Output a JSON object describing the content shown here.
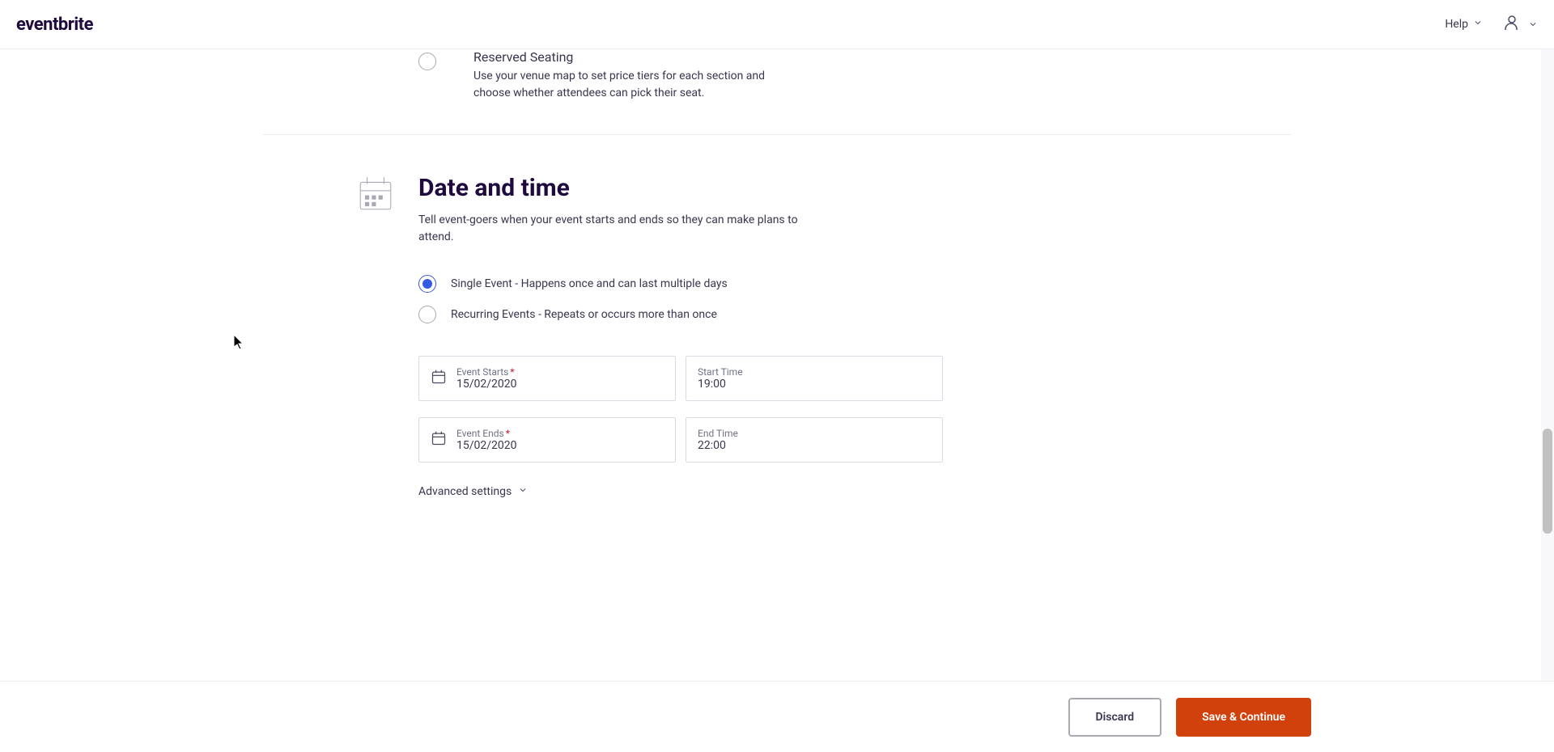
{
  "header": {
    "logo_text": "eventbrite",
    "help_label": "Help"
  },
  "seating": {
    "title": "Reserved Seating",
    "description": "Use your venue map to set price tiers for each section and choose whether attendees can pick their seat."
  },
  "date_section": {
    "heading": "Date and time",
    "description": "Tell event-goers when your event starts and ends so they can make plans to attend.",
    "radio_single": "Single Event - Happens once and can last multiple days",
    "radio_recurring": "Recurring Events - Repeats or occurs more than once",
    "event_starts_label": "Event Starts",
    "event_starts_value": "15/02/2020",
    "start_time_label": "Start Time",
    "start_time_value": "19:00",
    "event_ends_label": "Event Ends",
    "event_ends_value": "15/02/2020",
    "end_time_label": "End Time",
    "end_time_value": "22:00",
    "advanced_settings": "Advanced settings"
  },
  "footer": {
    "discard": "Discard",
    "save_continue": "Save & Continue"
  }
}
